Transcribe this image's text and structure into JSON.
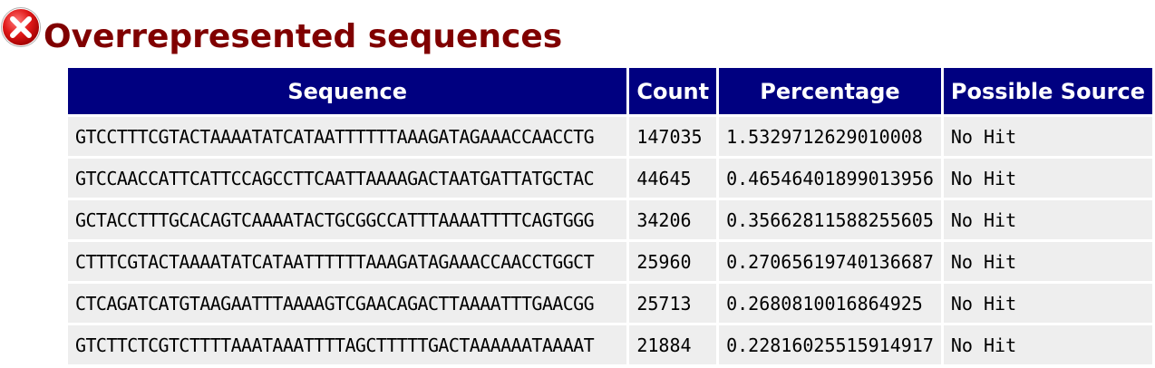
{
  "module": {
    "status": "fail",
    "status_icon": "error-x-icon",
    "title": "Overrepresented sequences",
    "title_color": "#800000",
    "header_color": "#000080",
    "row_color": "#eeeeee"
  },
  "table": {
    "headers": [
      "Sequence",
      "Count",
      "Percentage",
      "Possible Source"
    ],
    "rows": [
      {
        "sequence": "GTCCTTTCGTACTAAAATATCATAATTTTTTAAAGATAGAAACCAACCTG",
        "count": "147035",
        "percentage": "1.5329712629010008",
        "source": "No Hit"
      },
      {
        "sequence": "GTCCAACCATTCATTCCAGCCTTCAATTAAAAGACTAATGATTATGCTAC",
        "count": "44645",
        "percentage": "0.46546401899013956",
        "source": "No Hit"
      },
      {
        "sequence": "GCTACCTTTGCACAGTCAAAATACTGCGGCCATTTAAAATTTTCAGTGGG",
        "count": "34206",
        "percentage": "0.35662811588255605",
        "source": "No Hit"
      },
      {
        "sequence": "CTTTCGTACTAAAATATCATAATTTTTTAAAGATAGAAACCAACCTGGCT",
        "count": "25960",
        "percentage": "0.27065619740136687",
        "source": "No Hit"
      },
      {
        "sequence": "CTCAGATCATGTAAGAATTTAAAAGTCGAACAGACTTAAAATTTGAACGG",
        "count": "25713",
        "percentage": "0.2680810016864925",
        "source": "No Hit"
      },
      {
        "sequence": "GTCTTCTCGTCTTTTAAATAAATTTTAGCTTTTTGACTAAAAAATAAAAT",
        "count": "21884",
        "percentage": "0.22816025515914917",
        "source": "No Hit"
      }
    ]
  }
}
